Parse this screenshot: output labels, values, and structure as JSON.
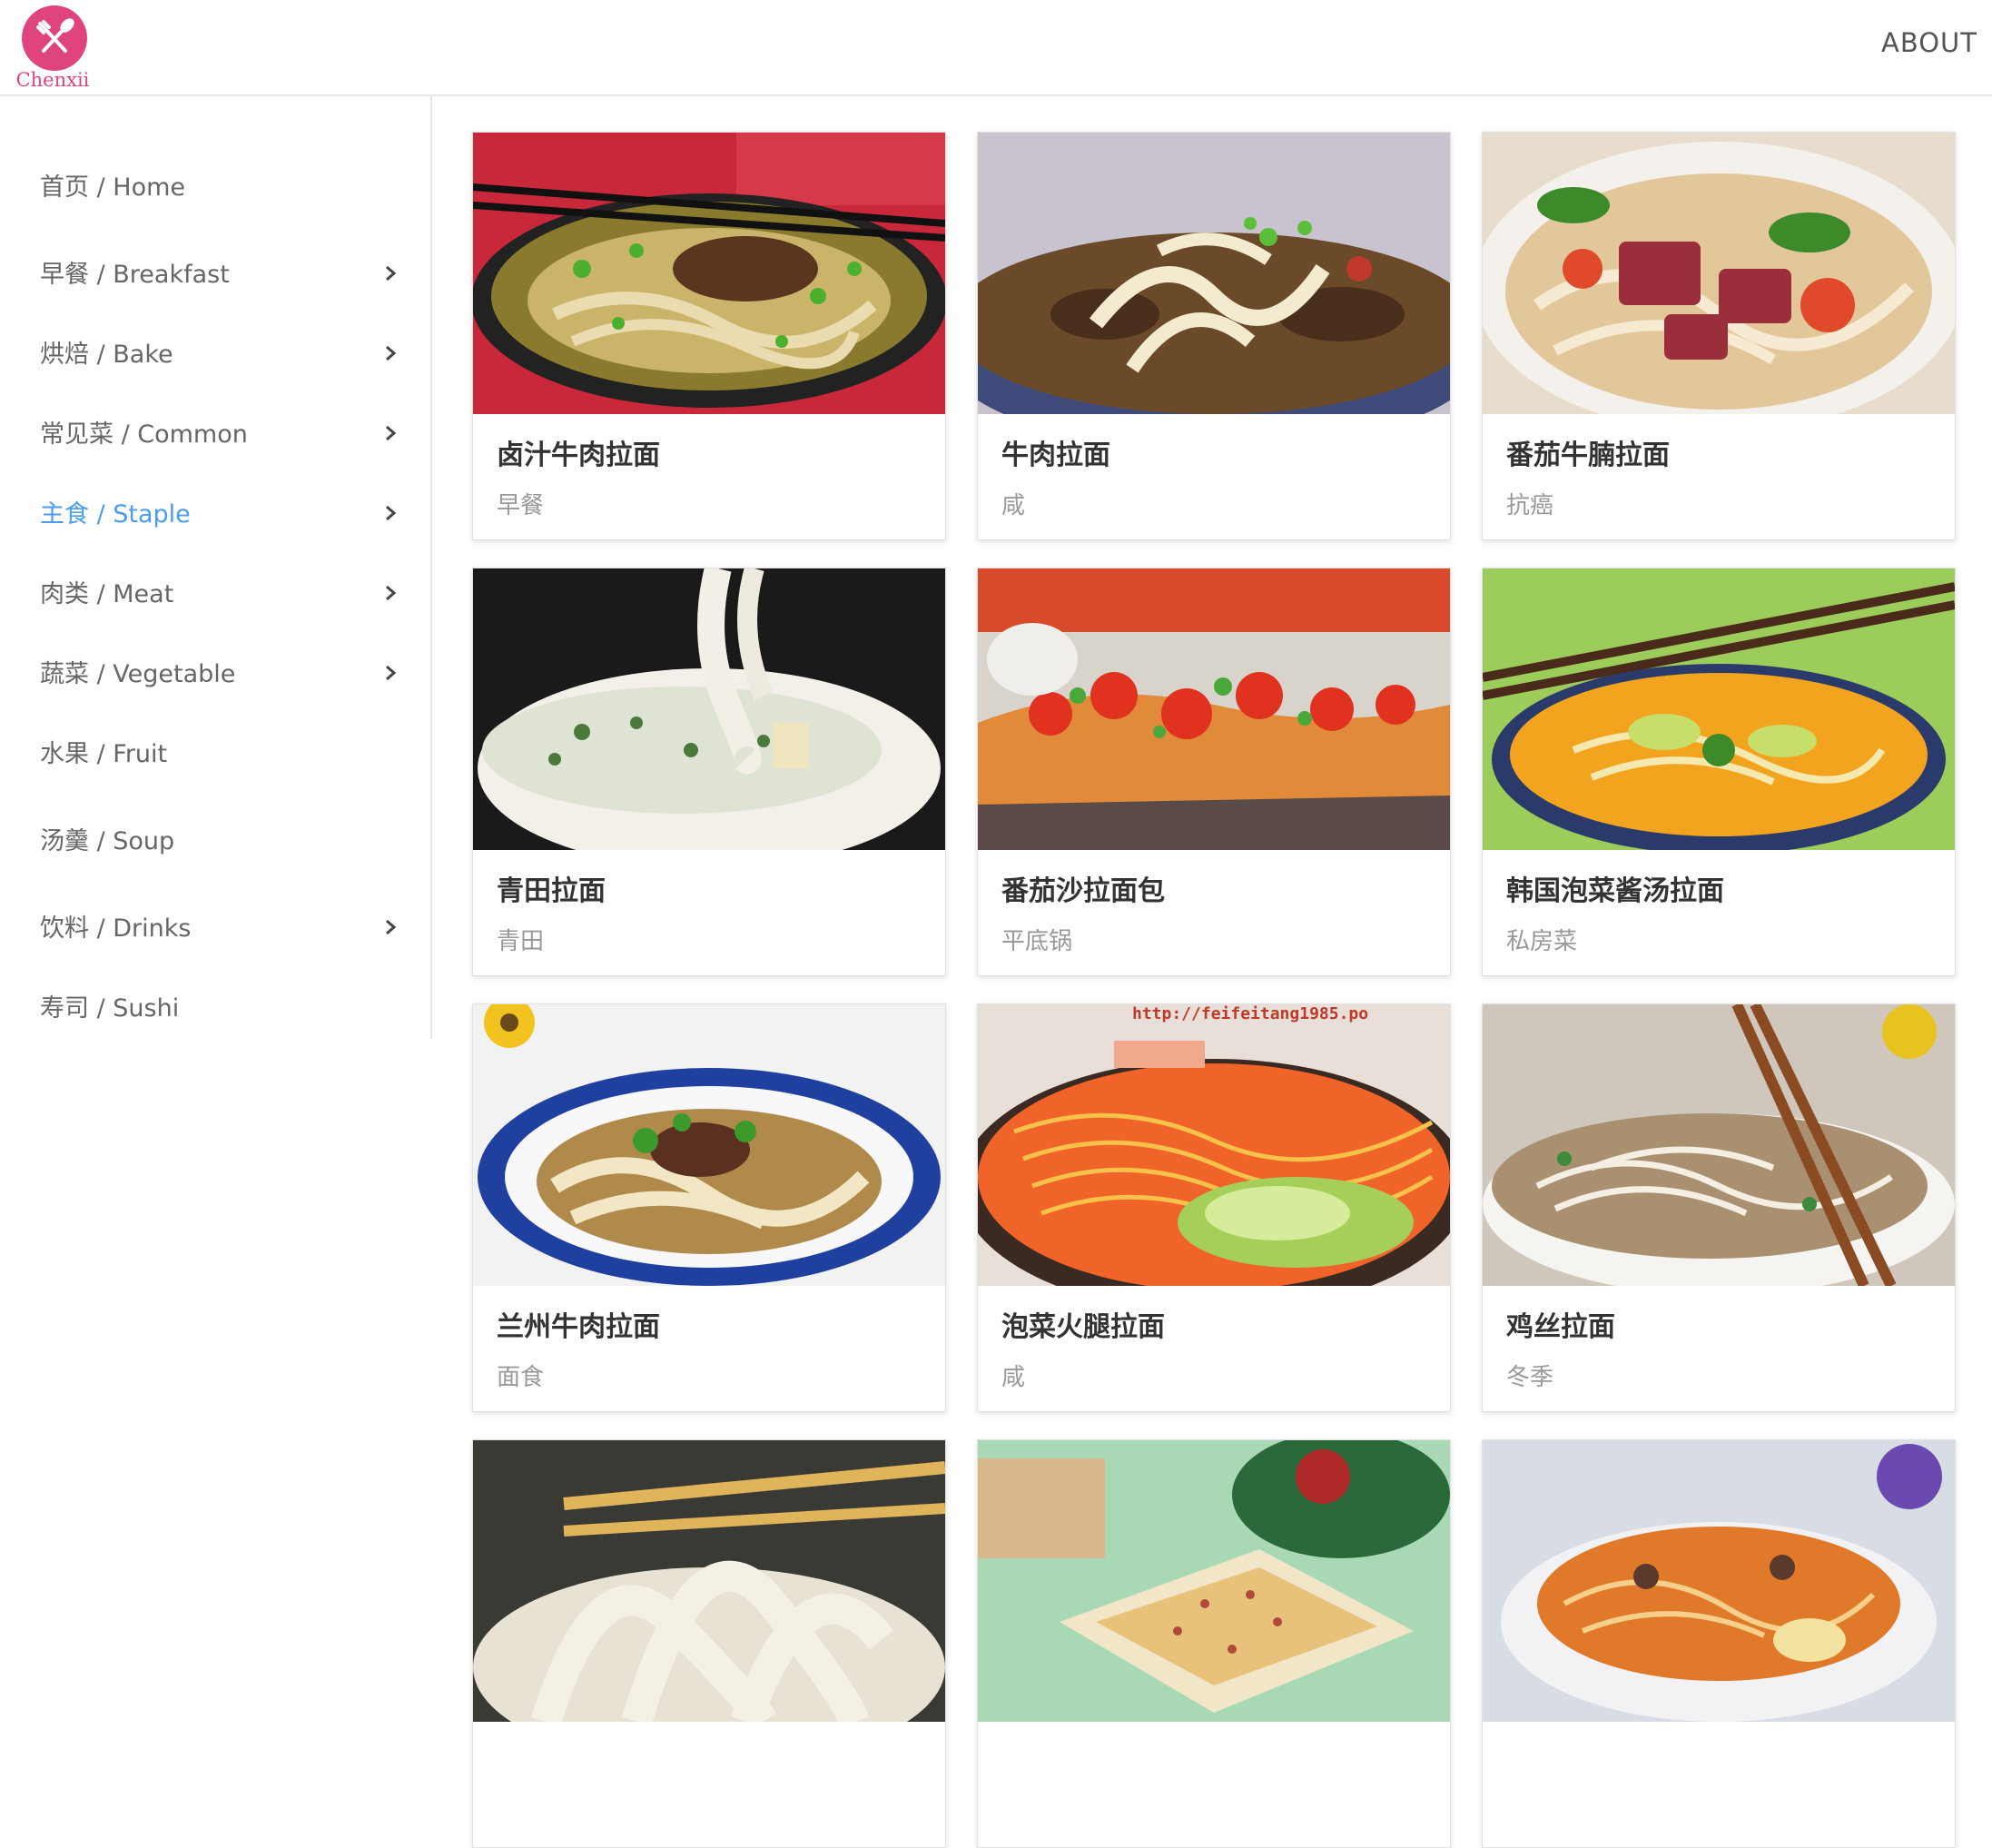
{
  "header": {
    "logo_text": "Chenxii",
    "about_label": "ABOUT"
  },
  "sidebar": {
    "items": [
      {
        "label": "首页 / Home"
      },
      {
        "label": "早餐 / Breakfast"
      },
      {
        "label": "烘焙 / Bake"
      },
      {
        "label": "常见菜 / Common"
      },
      {
        "label": "主食 / Staple"
      },
      {
        "label": "肉类 / Meat"
      },
      {
        "label": "蔬菜 / Vegetable"
      },
      {
        "label": "水果 / Fruit"
      },
      {
        "label": "汤羹 / Soup"
      },
      {
        "label": "饮料 / Drinks"
      },
      {
        "label": "寿司 / Sushi"
      }
    ]
  },
  "recipes": [
    {
      "title": "卤汁牛肉拉面",
      "tag": "早餐"
    },
    {
      "title": "牛肉拉面",
      "tag": "咸"
    },
    {
      "title": "番茄牛腩拉面",
      "tag": "抗癌"
    },
    {
      "title": "青田拉面",
      "tag": "青田"
    },
    {
      "title": "番茄沙拉面包",
      "tag": "平底锅"
    },
    {
      "title": "韩国泡菜酱汤拉面",
      "tag": "私房菜"
    },
    {
      "title": "兰州牛肉拉面",
      "tag": "面食"
    },
    {
      "title": "泡菜火腿拉面",
      "tag": "咸"
    },
    {
      "title": "鸡丝拉面",
      "tag": "冬季"
    },
    {
      "title": "",
      "tag": ""
    },
    {
      "title": "",
      "tag": ""
    },
    {
      "title": "",
      "tag": ""
    }
  ],
  "image_watermarks": {
    "url_text": "http://feifeitang1985.po"
  },
  "colors": {
    "brand": "#e0447f",
    "active_nav": "#4a9cf0"
  }
}
